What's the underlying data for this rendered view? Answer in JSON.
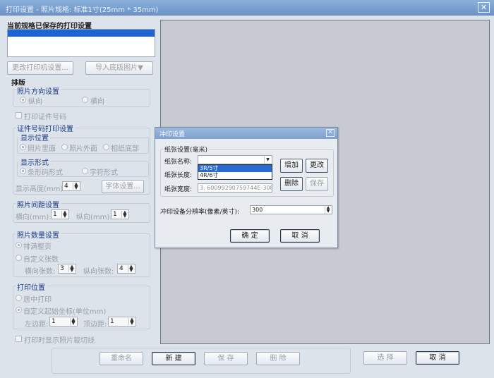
{
  "window": {
    "title": "打印设置 - 照片规格: 标准1寸(25mm * 35mm)",
    "close": "✕"
  },
  "saved": {
    "heading": "当前规格已保存的打印设置"
  },
  "buttons": {
    "change_printer": "更改打印机设置...",
    "import_bg": "导入底版图片▼",
    "font_settings": "字体设置...",
    "rename": "重命名",
    "new": "新  建",
    "save": "保  存",
    "delete": "删  除",
    "select": "选  择",
    "cancel": "取  消"
  },
  "layout_section": {
    "heading": "排版",
    "orientation": {
      "title": "照片方向设置",
      "portrait": "纵向",
      "landscape": "横向"
    },
    "print_id": "打印证件号码",
    "id_print": {
      "title": "证件号码打印设置",
      "pos_title": "显示位置",
      "pos_inside": "照片里面",
      "pos_outside": "照片外面",
      "pos_bottom": "相纸底部",
      "form_title": "显示形式",
      "form_barcode": "条形码形式",
      "form_text": "字符形式",
      "height_label": "显示高度(mm):",
      "height_val": "4"
    },
    "spacing": {
      "title": "照片间距设置",
      "h_label": "横向(mm):",
      "h_val": "1",
      "v_label": "纵向(mm):",
      "v_val": "1"
    },
    "quantity": {
      "title": "照片数量设置",
      "fill": "排满整页",
      "custom": "自定义张数",
      "h_label": "横向张数:",
      "h_val": "3",
      "v_label": "纵向张数:",
      "v_val": "4"
    },
    "position": {
      "title": "打印位置",
      "center": "居中打印",
      "custom": "自定义起始坐标(单位mm)",
      "left_label": "左边距:",
      "left_val": "1",
      "top_label": "顶边距:",
      "top_val": "1"
    },
    "cutline": "打印时显示照片裁切线"
  },
  "dialog": {
    "title": "冲印设置",
    "paper_group": "纸张设置(毫米)",
    "name_label": "纸张名称:",
    "length_label": "纸张长度:",
    "width_label": "纸张宽度:",
    "width_val": "3. 60099290759744E-308",
    "dropdown_items": [
      "3R/5寸",
      "4R/6寸"
    ],
    "add": "增加",
    "modify": "更改",
    "delete": "删除",
    "save": "保存",
    "res_label": "冲印设备分辨率(像素/英寸):",
    "res_val": "300",
    "ok": "确  定",
    "cancel": "取  消"
  }
}
